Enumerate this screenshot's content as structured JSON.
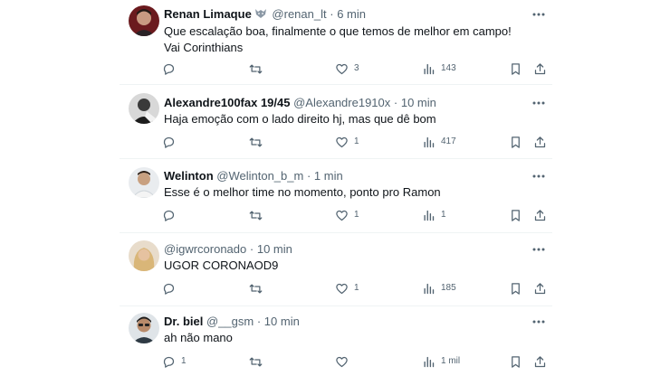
{
  "tweets": [
    {
      "name": "Renan Limaque",
      "handle": "@renan_lt",
      "sep": "·",
      "time": "6 min",
      "text": "Que escalação boa, finalmente o que temos de melhor em campo! Vai Corinthians",
      "replies": "",
      "retweets": "",
      "likes": "3",
      "views": "143"
    },
    {
      "name": "Alexandre100fax 19/45",
      "handle": "@Alexandre1910x",
      "sep": "·",
      "time": "10 min",
      "text": "Haja emoção com o lado direito hj, mas que dê bom",
      "replies": "",
      "retweets": "",
      "likes": "1",
      "views": "417"
    },
    {
      "name": "Welinton",
      "handle": "@Welinton_b_m",
      "sep": "·",
      "time": "1 min",
      "text": "Esse é o melhor time no momento, ponto pro Ramon",
      "replies": "",
      "retweets": "",
      "likes": "1",
      "views": "1"
    },
    {
      "name": "",
      "handle": "@igwrcoronado",
      "sep": "·",
      "time": "10 min",
      "text": "UGOR CORONAOD9",
      "replies": "",
      "retweets": "",
      "likes": "1",
      "views": "185"
    },
    {
      "name": "Dr. biel",
      "handle": "@__gsm",
      "sep": "·",
      "time": "10 min",
      "text": "ah não mano",
      "replies": "1",
      "retweets": "",
      "likes": "",
      "views": "1 mil"
    }
  ],
  "icons": {
    "reply": "reply-icon",
    "retweet": "retweet-icon",
    "like": "like-icon",
    "views": "views-icon",
    "bookmark": "bookmark-icon",
    "share": "share-icon",
    "more": "more-icon",
    "badge": "wolf-badge-icon"
  },
  "colors": {
    "text": "#0f1419",
    "secondary": "#536471",
    "divider": "#eff3f4"
  }
}
